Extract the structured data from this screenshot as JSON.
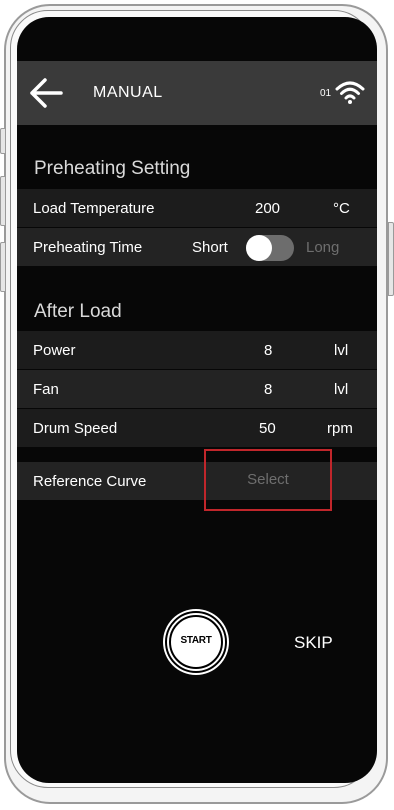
{
  "header": {
    "title": "MANUAL",
    "signal_number": "01",
    "back_icon": "arrow-left-icon",
    "wifi_icon": "wifi-icon"
  },
  "preheating": {
    "title": "Preheating Setting",
    "load_temperature": {
      "label": "Load Temperature",
      "value": "200",
      "unit": "°C"
    },
    "preheating_time": {
      "label": "Preheating Time",
      "short": "Short",
      "long": "Long"
    }
  },
  "after_load": {
    "title": "After Load",
    "power": {
      "label": "Power",
      "value": "8",
      "unit": "lvl"
    },
    "fan": {
      "label": "Fan",
      "value": "8",
      "unit": "lvl"
    },
    "drum_speed": {
      "label": "Drum Speed",
      "value": "50",
      "unit": "rpm"
    }
  },
  "reference_curve": {
    "label": "Reference Curve",
    "select": "Select"
  },
  "actions": {
    "start": "START",
    "skip": "SKIP"
  },
  "colors": {
    "screen_bg": "#070707",
    "header_bg": "#3a3a3a",
    "row_bg": "#1c1c1c",
    "highlight": "#c0262b"
  }
}
